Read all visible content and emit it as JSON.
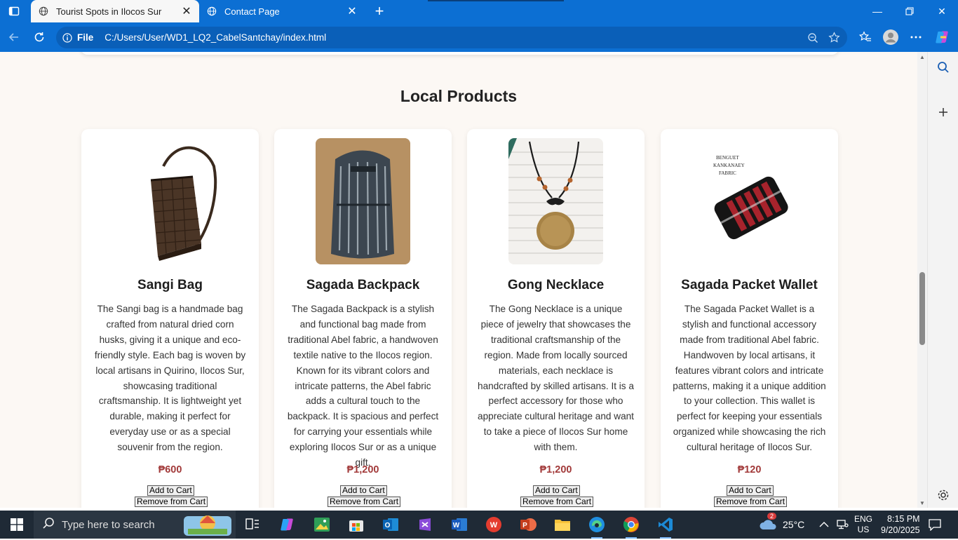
{
  "browser": {
    "tabs": [
      {
        "title": "Tourist Spots in Ilocos Sur",
        "active": true
      },
      {
        "title": "Contact Page",
        "active": false
      }
    ],
    "address": {
      "scheme": "File",
      "url": "C:/Users/User/WD1_LQ2_CabelSantchay/index.html"
    }
  },
  "page": {
    "section_title": "Local Products",
    "products": [
      {
        "name": "Sangi Bag",
        "description": "The Sangi bag is a handmade bag crafted from natural dried corn husks, giving it a unique and eco-friendly style. Each bag is woven by local artisans in Quirino, Ilocos Sur, showcasing traditional craftsmanship. It is lightweight yet durable, making it perfect for everyday use or as a special souvenir from the region.",
        "price": "₱600",
        "add_label": "Add to Cart",
        "remove_label": "Remove from Cart"
      },
      {
        "name": "Sagada Backpack",
        "description": "The Sagada Backpack is a stylish and functional bag made from traditional Abel fabric, a handwoven textile native to the Ilocos region. Known for its vibrant colors and intricate patterns, the Abel fabric adds a cultural touch to the backpack. It is spacious and perfect for carrying your essentials while exploring Ilocos Sur or as a unique gift.",
        "price": "₱1,200",
        "add_label": "Add to Cart",
        "remove_label": "Remove from Cart"
      },
      {
        "name": "Gong Necklace",
        "description": "The Gong Necklace is a unique piece of jewelry that showcases the traditional craftsmanship of the region. Made from locally sourced materials, each necklace is handcrafted by skilled artisans. It is a perfect accessory for those who appreciate cultural heritage and want to take a piece of Ilocos Sur home with them.",
        "price": "₱1,200",
        "add_label": "Add to Cart",
        "remove_label": "Remove from Cart"
      },
      {
        "name": "Sagada Packet Wallet",
        "description": "The Sagada Packet Wallet is a stylish and functional accessory made from traditional Abel fabric. Handwoven by local artisans, it features vibrant colors and intricate patterns, making it a unique addition to your collection. This wallet is perfect for keeping your essentials organized while showcasing the rich cultural heritage of Ilocos Sur.",
        "price": "₱120",
        "add_label": "Add to Cart",
        "remove_label": "Remove from Cart",
        "image_caption": "BENGUET KANKANAEY FABRIC"
      }
    ]
  },
  "taskbar": {
    "search_placeholder": "Type here to search",
    "weather": "25°C",
    "weather_badge": "2",
    "lang_line1": "ENG",
    "lang_line2": "US",
    "time": "8:15 PM",
    "date": "9/20/2025"
  },
  "colors": {
    "browser_blue": "#0c6fd3",
    "page_bg": "#fcf8f4",
    "price_red": "#a23a3a",
    "taskbar": "#1f2a36"
  }
}
